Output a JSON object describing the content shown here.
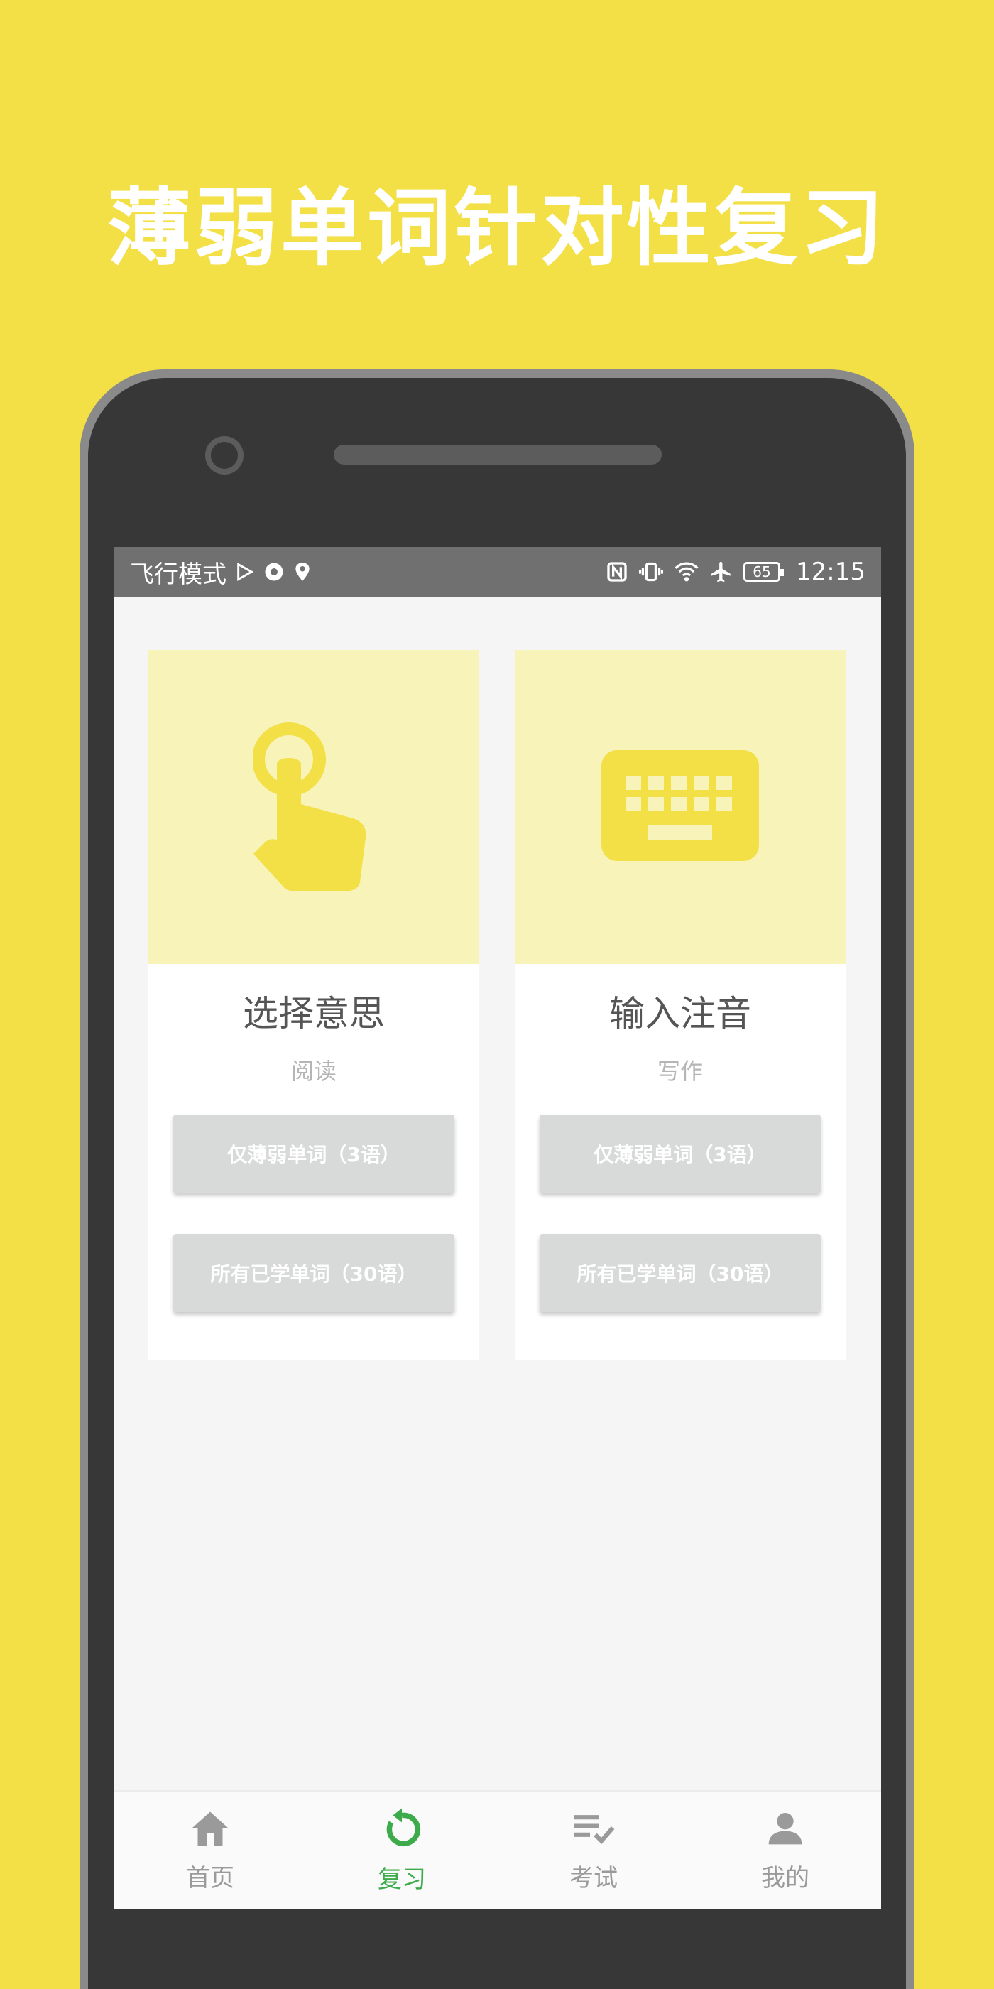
{
  "headline": "薄弱单词针对性复习",
  "status_bar": {
    "mode_text": "飞行模式",
    "battery_level": "65",
    "time": "12:15"
  },
  "cards": [
    {
      "icon": "touch-app-icon",
      "title": "选择意思",
      "subtitle": "阅读",
      "buttons": [
        "仅薄弱单词（3语）",
        "所有已学单词（30语）"
      ]
    },
    {
      "icon": "keyboard-icon",
      "title": "输入注音",
      "subtitle": "写作",
      "buttons": [
        "仅薄弱单词（3语）",
        "所有已学单词（30语）"
      ]
    }
  ],
  "bottom_nav": [
    {
      "label": "首页",
      "icon": "home-icon",
      "active": false
    },
    {
      "label": "复习",
      "icon": "review-icon",
      "active": true
    },
    {
      "label": "考试",
      "icon": "exam-icon",
      "active": false
    },
    {
      "label": "我的",
      "icon": "person-icon",
      "active": false
    }
  ],
  "colors": {
    "background": "#F3DF46",
    "accent_icon": "#F3DF46",
    "hero_background": "#F8F3B9",
    "active_nav": "#3DAB4B",
    "inactive_nav": "#9a9a9a",
    "button_background": "#D8D9D9"
  }
}
